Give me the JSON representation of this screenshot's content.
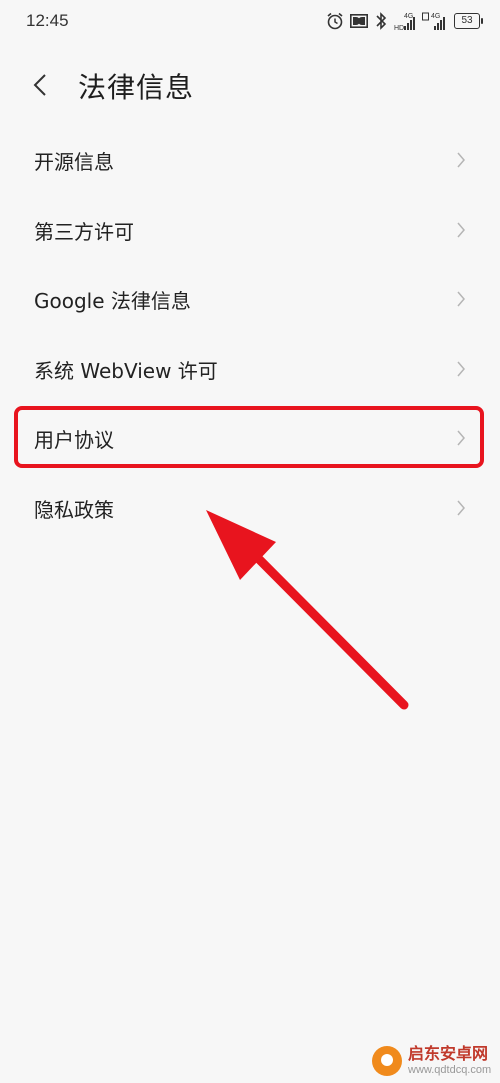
{
  "status_bar": {
    "time": "12:45",
    "battery": "53",
    "network_1": "4G",
    "hd_label": "HD",
    "network_2": "4G"
  },
  "header": {
    "title": "法律信息"
  },
  "menu": {
    "items": [
      {
        "label": "开源信息"
      },
      {
        "label": "第三方许可"
      },
      {
        "label": "Google 法律信息"
      },
      {
        "label": "系统 WebView 许可"
      },
      {
        "label": "用户协议"
      },
      {
        "label": "隐私政策"
      }
    ]
  },
  "annotation": {
    "highlight_color": "#e8141e",
    "highlighted_item": "用户协议"
  },
  "watermark": {
    "name": "启东安卓网",
    "url": "www.qdtdcq.com"
  }
}
